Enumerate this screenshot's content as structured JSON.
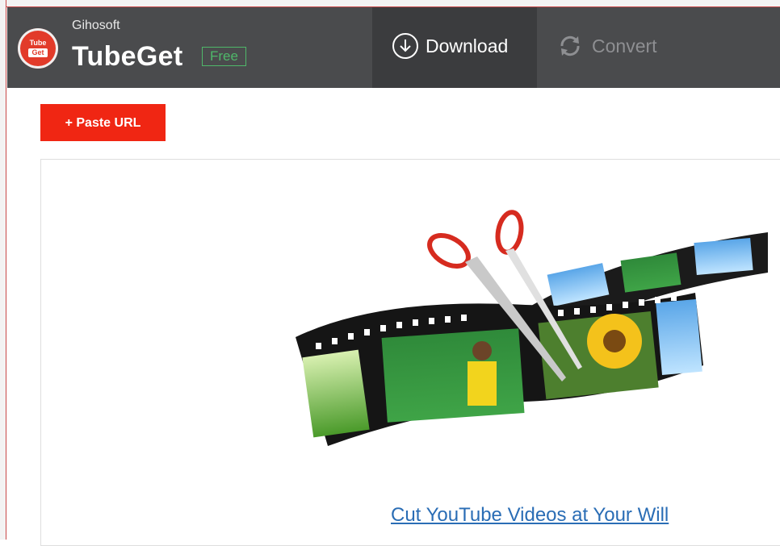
{
  "header": {
    "company": "Gihosoft",
    "app_name": "TubeGet",
    "edition_badge": "Free",
    "logo_text_line1": "Tube",
    "logo_text_line2": "Get",
    "tabs": [
      {
        "label": "Download",
        "icon": "download-circle-icon",
        "active": true
      },
      {
        "label": "Convert",
        "icon": "refresh-icon",
        "active": false
      }
    ]
  },
  "toolbar": {
    "paste_url_label": "+ Paste URL"
  },
  "main": {
    "promo_link": "Cut YouTube Videos at Your Will"
  },
  "colors": {
    "header_bg": "#4a4b4d",
    "active_tab_bg": "#3b3c3e",
    "accent_red": "#f02613",
    "free_green": "#4fb86a",
    "link_blue": "#2a6db5"
  }
}
